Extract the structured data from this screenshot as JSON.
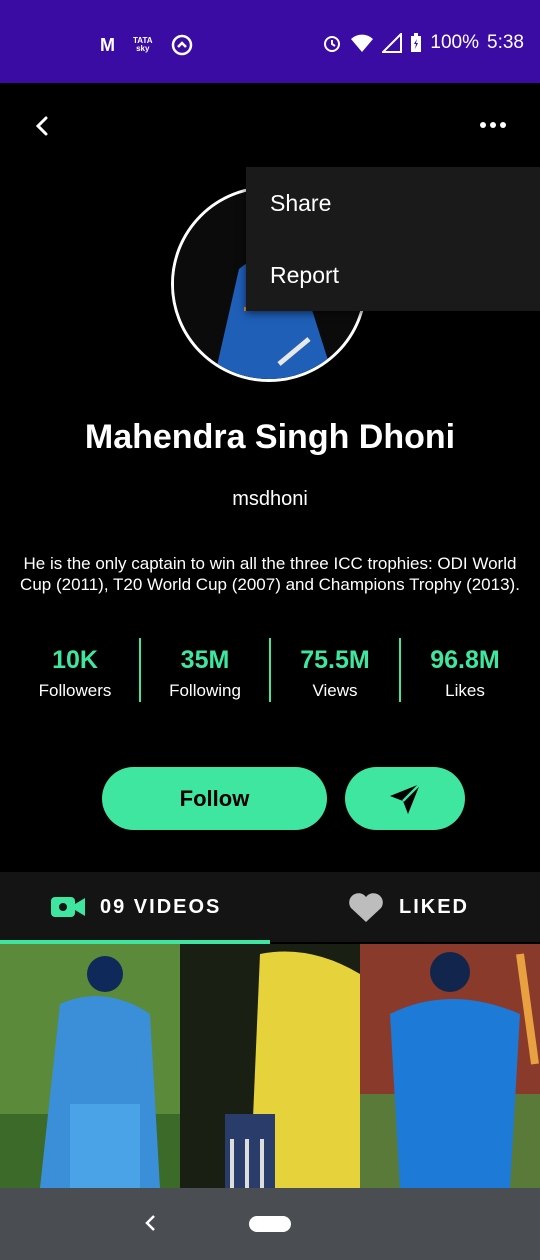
{
  "status_bar": {
    "battery": "100%",
    "time": "5:38",
    "tata_line1": "TATA",
    "tata_line2": "sky",
    "color": "#3a0ca3"
  },
  "menu": {
    "items": [
      "Share",
      "Report"
    ]
  },
  "profile": {
    "name": "Mahendra Singh Dhoni",
    "username": "msdhoni",
    "bio": "He is the only captain to win all the three ICC trophies: ODI World Cup (2011), T20 World Cup (2007) and Champions Trophy (2013)."
  },
  "stats": [
    {
      "value": "10K",
      "label": "Followers"
    },
    {
      "value": "35M",
      "label": "Following"
    },
    {
      "value": "75.5M",
      "label": "Views"
    },
    {
      "value": "96.8M",
      "label": "Likes"
    }
  ],
  "actions": {
    "follow_label": "Follow",
    "send_icon": "send-icon"
  },
  "tabs": {
    "videos_label": "09 VIDEOS",
    "liked_label": "LIKED"
  },
  "colors": {
    "accent": "#3ee6a0",
    "background": "#000000",
    "menu_bg": "#1a1a1a",
    "nav_bar": "#4a4d52"
  }
}
